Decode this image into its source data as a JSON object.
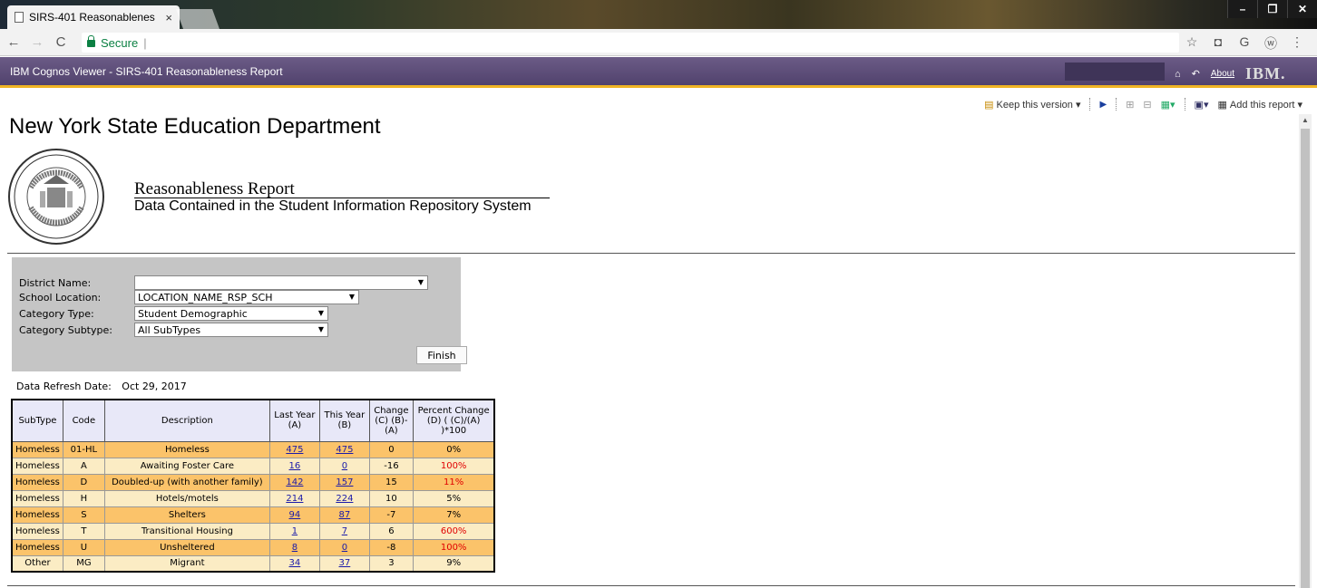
{
  "browser": {
    "tab_title": "SIRS-401 Reasonablenes",
    "tab_close": "×",
    "secure_label": "Secure",
    "window_controls": [
      "–",
      "❐",
      "✕"
    ]
  },
  "cognos": {
    "title": "IBM Cognos Viewer - SIRS-401 Reasonableness Report",
    "about": "About",
    "ibm": "IBM."
  },
  "toolbar": {
    "keep_version": "Keep this version ▾",
    "add_report": "Add this report ▾"
  },
  "report": {
    "org": "New York State Education Department",
    "name": "Reasonableness Report",
    "subtitle": "Data Contained in the Student Information Repository System"
  },
  "prompts": {
    "district_label": "District Name:",
    "district_value": "",
    "school_label": "School Location:",
    "school_value": "LOCATION_NAME_RSP_SCH",
    "category_label": "Category Type:",
    "category_value": "Student Demographic",
    "subtype_label": "Category Subtype:",
    "subtype_value": "All SubTypes",
    "finish": "Finish"
  },
  "refresh": {
    "label": "Data Refresh Date:",
    "value": "Oct 29, 2017"
  },
  "table": {
    "headers": {
      "subtype": "SubType",
      "code": "Code",
      "description": "Description",
      "last_year": "Last Year (A)",
      "this_year": "This Year (B)",
      "change": "Change (C) (B)-(A)",
      "pct": "Percent Change (D) ( (C)/(A) )*100"
    },
    "rows": [
      {
        "subtype": "Homeless",
        "code": "01-HL",
        "description": "Homeless",
        "last": "475",
        "this": "475",
        "change": "0",
        "pct": "0%",
        "pct_red": false
      },
      {
        "subtype": "Homeless",
        "code": "A",
        "description": "Awaiting Foster Care",
        "last": "16",
        "this": "0",
        "change": "-16",
        "pct": "100%",
        "pct_red": true
      },
      {
        "subtype": "Homeless",
        "code": "D",
        "description": "Doubled-up (with another family)",
        "last": "142",
        "this": "157",
        "change": "15",
        "pct": "11%",
        "pct_red": true
      },
      {
        "subtype": "Homeless",
        "code": "H",
        "description": "Hotels/motels",
        "last": "214",
        "this": "224",
        "change": "10",
        "pct": "5%",
        "pct_red": false
      },
      {
        "subtype": "Homeless",
        "code": "S",
        "description": "Shelters",
        "last": "94",
        "this": "87",
        "change": "-7",
        "pct": "7%",
        "pct_red": false
      },
      {
        "subtype": "Homeless",
        "code": "T",
        "description": "Transitional Housing",
        "last": "1",
        "this": "7",
        "change": "6",
        "pct": "600%",
        "pct_red": true
      },
      {
        "subtype": "Homeless",
        "code": "U",
        "description": "Unsheltered",
        "last": "8",
        "this": "0",
        "change": "-8",
        "pct": "100%",
        "pct_red": true
      },
      {
        "subtype": "Other",
        "code": "MG",
        "description": "Migrant",
        "last": "34",
        "this": "37",
        "change": "3",
        "pct": "9%",
        "pct_red": false
      }
    ]
  },
  "colors": {
    "header_purple": "#51426d",
    "header_accent": "#f0b323",
    "row_odd": "#fbc36a",
    "row_even": "#fbecc4",
    "alert_red": "#e00000"
  }
}
